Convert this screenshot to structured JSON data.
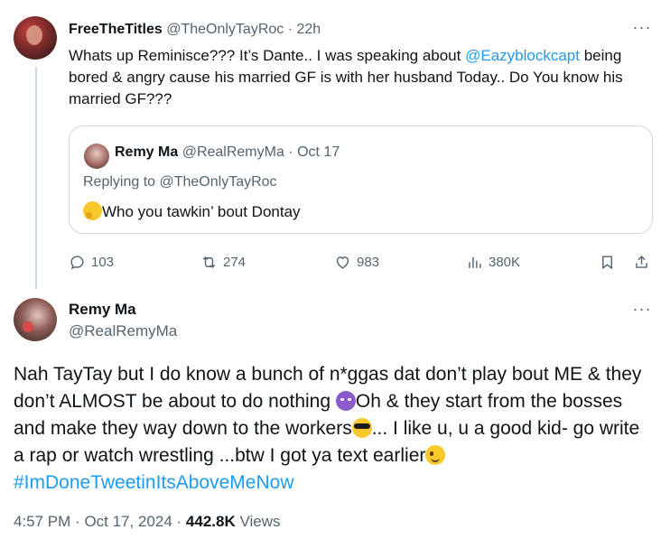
{
  "tweet1": {
    "name": "FreeTheTitles",
    "handle": "@TheOnlyTayRoc",
    "sep": "·",
    "time": "22h",
    "text_part1": "Whats up Reminisce??? It’s Dante.. I was speaking about ",
    "mention": "@Eazyblockcapt",
    "text_part2": " being bored & angry cause his married GF is with her husband Today.. Do You know his married GF???",
    "more": "···"
  },
  "quote": {
    "name": "Remy Ma",
    "handle": "@RealRemyMa",
    "sep": "·",
    "date": "Oct 17",
    "replying": "Replying to @TheOnlyTayRoc",
    "text": "Who you tawkin’ bout Dontay",
    "emoji": "thinking-face"
  },
  "actions": {
    "replies": "103",
    "reposts": "274",
    "likes": "983",
    "views": "380K"
  },
  "tweet2": {
    "name": "Remy Ma",
    "handle": "@RealRemyMa",
    "more": "···",
    "text_a": "Nah TayTay but I do know a bunch of n*ggas dat don’t play bout ME & they don’t ALMOST be about to do nothing ",
    "text_b": "Oh & they start from the bosses and make they way down to the workers",
    "text_c": "... I like u, u a good kid- go write a rap or watch wrestling ...btw I got ya text earlier",
    "hashtag": "#ImDoneTweetinItsAboveMeNow",
    "time": "4:57 PM",
    "date": "Oct 17, 2024",
    "views_count": "442.8K",
    "views_label": "Views"
  },
  "colors": {
    "accent": "#1d9bf0",
    "secondary_text": "#536471",
    "border": "#cfd9de"
  }
}
